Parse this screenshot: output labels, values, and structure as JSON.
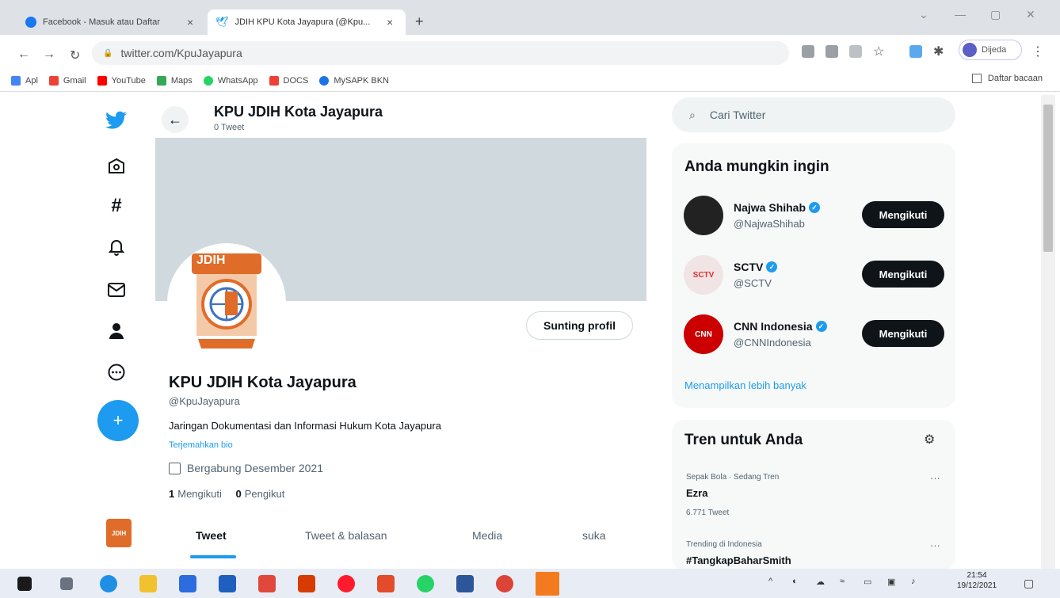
{
  "browser": {
    "tabs": [
      {
        "title": "Facebook - Masuk atau Daftar",
        "active": false
      },
      {
        "title": "JDIH KPU Kota Jayapura (@Kpu...",
        "active": true
      }
    ],
    "url": "twitter.com/KpuJayapura",
    "profile_label": "Dijeda",
    "bookmarks": [
      {
        "label": "Apl",
        "color": "#4285f4"
      },
      {
        "label": "Gmail",
        "color": "#ea4335"
      },
      {
        "label": "YouTube",
        "color": "#ff0000"
      },
      {
        "label": "Maps",
        "color": "#34a853"
      },
      {
        "label": "WhatsApp",
        "color": "#25d366"
      },
      {
        "label": "DOCS",
        "color": "#ea4335"
      },
      {
        "label": "MySAPK BKN",
        "color": "#1a73e8"
      }
    ],
    "reading_list": "Daftar bacaan"
  },
  "twitter": {
    "nav_icons": [
      "twitter-logo-icon",
      "explore-home-icon",
      "hashtag-icon",
      "notifications-bell-icon",
      "messages-mail-icon",
      "profile-person-icon",
      "more-circle-icon"
    ],
    "compose_icon": "+",
    "header": {
      "name": "KPU JDIH Kota Jayapura",
      "tweet_count": "0 Tweet"
    },
    "profile": {
      "avatar_text": "JDIH",
      "edit_label": "Sunting profil",
      "name": "KPU JDIH Kota Jayapura",
      "handle": "@KpuJayapura",
      "bio": "Jaringan Dokumentasi dan Informasi Hukum Kota Jayapura",
      "translate": "Terjemahkan bio",
      "joined": "Bergabung Desember 2021",
      "following_count": "1",
      "following_label": "Mengikuti",
      "followers_count": "0",
      "followers_label": "Pengikut",
      "tabs": [
        "Tweet",
        "Tweet & balasan",
        "Media",
        "suka"
      ]
    },
    "search_placeholder": "Cari Twitter",
    "who_to_follow": {
      "title": "Anda mungkin ingin",
      "users": [
        {
          "name": "Najwa Shihab",
          "handle": "@NajwaShihab",
          "button": "Mengikuti",
          "avatar_text": ""
        },
        {
          "name": "SCTV",
          "handle": "@SCTV",
          "button": "Mengikuti",
          "avatar_text": "SCTV"
        },
        {
          "name": "CNN Indonesia",
          "handle": "@CNNIndonesia",
          "button": "Mengikuti",
          "avatar_text": "CNN"
        }
      ],
      "show_more": "Menampilkan lebih banyak"
    },
    "trends": {
      "title": "Tren untuk Anda",
      "items": [
        {
          "meta": "Sepak Bola · Sedang Tren",
          "name": "Ezra",
          "count": "6.771 Tweet"
        },
        {
          "meta": "Trending di Indonesia",
          "name": "#TangkapBaharSmith",
          "count": ""
        }
      ]
    }
  },
  "taskbar": {
    "time": "21:54",
    "date": "19/12/2021"
  }
}
